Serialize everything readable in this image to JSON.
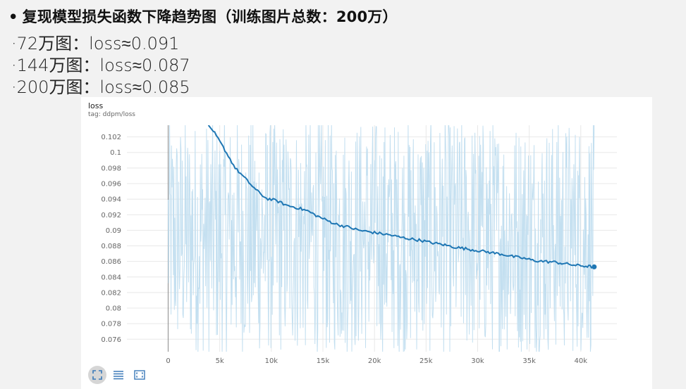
{
  "slide": {
    "title": "复现模型损失函数下降趋势图（训练图片总数：200万）",
    "bullet": "•",
    "notes": [
      "·72万图：loss≈0.091",
      "·144万图：loss≈0.087",
      "·200万图：loss≈0.085"
    ]
  },
  "card": {
    "title": "loss",
    "tag": "tag: ddpm/loss",
    "toolbar": [
      {
        "icon": "fullscreen-icon",
        "active": true
      },
      {
        "icon": "list-icon",
        "active": false
      },
      {
        "icon": "fit-domain-icon",
        "active": false
      }
    ]
  },
  "chart_data": {
    "type": "line",
    "title": "loss",
    "subtitle": "tag: ddpm/loss",
    "xlabel": "",
    "ylabel": "",
    "x_ticks": [
      0,
      5000,
      10000,
      15000,
      20000,
      25000,
      30000,
      35000,
      40000
    ],
    "x_tick_labels": [
      "0",
      "5k",
      "10k",
      "15k",
      "20k",
      "25k",
      "30k",
      "35k",
      "40k"
    ],
    "y_ticks": [
      0.076,
      0.078,
      0.08,
      0.082,
      0.084,
      0.086,
      0.088,
      0.09,
      0.092,
      0.094,
      0.096,
      0.098,
      0.1,
      0.102
    ],
    "y_tick_labels": [
      "0.076",
      "0.078",
      "0.08",
      "0.082",
      "0.084",
      "0.086",
      "0.088",
      "0.09",
      "0.092",
      "0.094",
      "0.096",
      "0.098",
      "0.1",
      "0.102"
    ],
    "xlim": [
      -4000,
      43500
    ],
    "ylim": [
      0.0744,
      0.1035
    ],
    "grid": true,
    "colors": {
      "smoothed": "#1f77b4",
      "raw": "#c3dff0",
      "axis": "#888888",
      "grid": "#e8e8e8"
    },
    "smoothed": {
      "x": [
        3900,
        4500,
        5500,
        6500,
        7500,
        8500,
        9500,
        10500,
        11500,
        12500,
        13500,
        14500,
        15500,
        16500,
        17500,
        18500,
        19500,
        20500,
        21500,
        22500,
        23500,
        24500,
        25500,
        26500,
        27500,
        28500,
        29500,
        30500,
        31500,
        32500,
        33500,
        34500,
        35500,
        36500,
        37500,
        38500,
        39500,
        40500,
        41300
      ],
      "y": [
        0.1035,
        0.1025,
        0.1003,
        0.098,
        0.0966,
        0.0952,
        0.0941,
        0.0938,
        0.0932,
        0.0929,
        0.0925,
        0.0918,
        0.0912,
        0.0907,
        0.0904,
        0.09,
        0.0898,
        0.0896,
        0.0894,
        0.0891,
        0.0889,
        0.0887,
        0.0884,
        0.0882,
        0.0879,
        0.0877,
        0.0875,
        0.0873,
        0.0871,
        0.0869,
        0.0866,
        0.0864,
        0.0861,
        0.086,
        0.0859,
        0.0857,
        0.0855,
        0.0854,
        0.0853
      ]
    },
    "raw_series": {
      "x_range": [
        0,
        41300
      ],
      "y_range": [
        0.0744,
        0.1035
      ],
      "description": "noisy per-step loss spanning the full y range"
    },
    "last_point": {
      "x": 41300,
      "y": 0.0853
    }
  }
}
